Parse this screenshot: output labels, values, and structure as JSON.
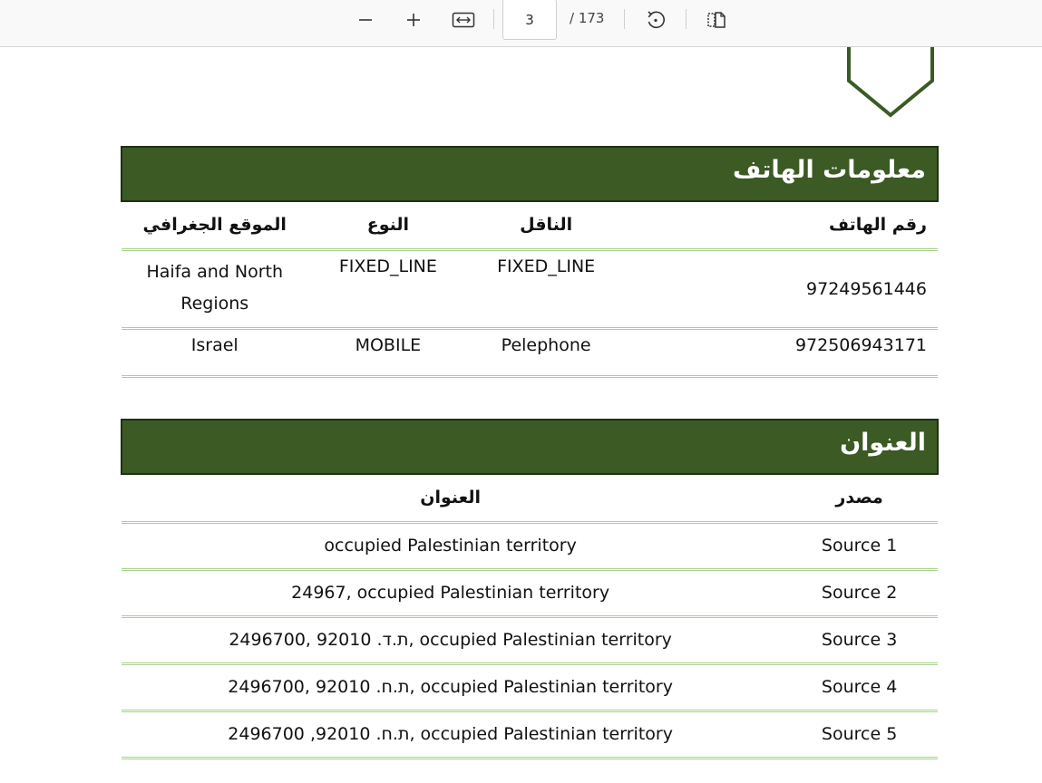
{
  "viewer": {
    "current_page": "3",
    "page_total": "/ 173"
  },
  "phone_section": {
    "title": "معلومات الهاتف",
    "headers": {
      "phone_number": "رقم الهاتف",
      "carrier": "الناقل",
      "type": "النوع",
      "location": "الموقع الجغرافي"
    },
    "rows": [
      {
        "phone_number": "97249561446",
        "carrier": "FIXED_LINE",
        "type": "FIXED_LINE",
        "location": "Haifa and North Regions"
      },
      {
        "phone_number": "972506943171",
        "carrier": "Pelephone",
        "type": "MOBILE",
        "location": "Israel"
      }
    ]
  },
  "address_section": {
    "title": "العنوان",
    "headers": {
      "source": "مصدر",
      "address": "العنوان"
    },
    "rows": [
      {
        "source": "Source 1",
        "address": "occupied Palestinian territory"
      },
      {
        "source": "Source 2",
        "address": "24967, occupied Palestinian territory"
      },
      {
        "source": "Source 3",
        "address": "2496700, 92010 .ת.ד, occupied Palestinian territory"
      },
      {
        "source": "Source 4",
        "address": "2496700, 92010 .ת.ח, occupied Palestinian territory"
      },
      {
        "source": "Source 5",
        "address": "2496700 ,92010 .ת.ח, occupied Palestinian territory"
      }
    ]
  },
  "colors": {
    "section_header_bg": "#3b5a24",
    "row_border": "#a8d08d",
    "shield_stroke": "#3b5a24"
  }
}
